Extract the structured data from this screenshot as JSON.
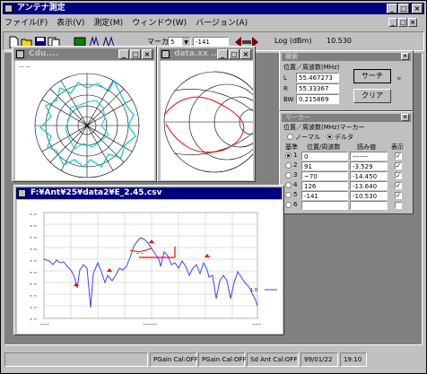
{
  "app": {
    "title": "アンテナ測定"
  },
  "menu": [
    "ファイル(F)",
    "表示(V)",
    "測定(M)",
    "ウィンドウ(W)",
    "バージョン(A)"
  ],
  "toolbar": {
    "marker_label": "マーカ",
    "marker_number": "5",
    "marker_value": "-141",
    "log_label": "Log (dBm)",
    "log_value": "10.530"
  },
  "polar_window": {
    "title": "Cdu...."
  },
  "smith_window": {
    "title": "data.xx ..."
  },
  "search_panel": {
    "title": "検索",
    "heading": "位置／周波数(MHz)",
    "rows": [
      {
        "label": "L",
        "value": "55.467273"
      },
      {
        "label": "R",
        "value": "55.33367"
      },
      {
        "label": "BW",
        "value": "0.215869"
      }
    ],
    "search_button": "サーチ",
    "clear_button": "クリア"
  },
  "marker_panel": {
    "title": "マーカー",
    "heading": "位置／周波数(MHz)マーカー",
    "mode_normal": "ノーマル",
    "mode_delta": "デルタ",
    "columns": [
      "基準",
      "位置/周波数",
      "読み値",
      "表示"
    ],
    "rows": [
      {
        "num": "1",
        "pos": "0",
        "read": "-------",
        "shown": true,
        "ref": true
      },
      {
        "num": "2",
        "pos": "91",
        "read": "-3.529",
        "shown": true,
        "ref": false
      },
      {
        "num": "3",
        "pos": "~70",
        "read": "-14.450",
        "shown": true,
        "ref": false
      },
      {
        "num": "4",
        "pos": "126",
        "read": "-13.640",
        "shown": true,
        "ref": false
      },
      {
        "num": "5",
        "pos": "-141",
        "read": "-10.530",
        "shown": true,
        "ref": false
      },
      {
        "num": "6",
        "pos": "",
        "read": "",
        "shown": false,
        "ref": false
      }
    ]
  },
  "plot_window": {
    "title": "F:¥Ant¥25¥data2¥E_2.45.csv",
    "legend_label": "1.0"
  },
  "status": [
    "PGain Cal:OFF",
    "PGain Cal:OFF",
    "Sd Ant Cal:OFF",
    "99/01/22",
    "19:10"
  ],
  "colors": {
    "title_active": "#000080",
    "trace": "#4040ff",
    "marker": "#ff0000",
    "smith_trace": "#ff0000",
    "polar_trace": "#00c8d8"
  }
}
